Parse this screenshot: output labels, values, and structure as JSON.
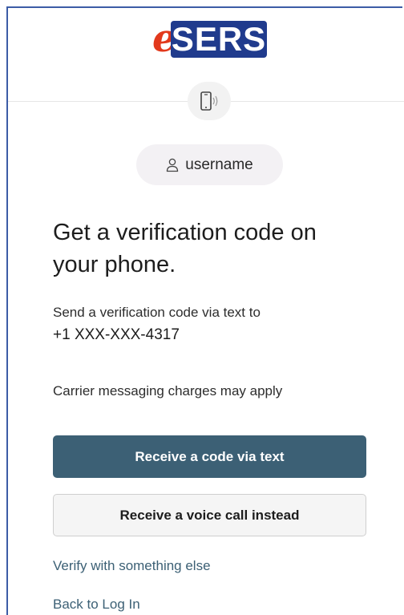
{
  "logo": {
    "prefix": "e",
    "text": "SERS"
  },
  "icons": {
    "phone": "smartphone-vibrate-icon",
    "user": "user-icon"
  },
  "user": {
    "username": "username"
  },
  "main": {
    "heading": "Get a verification code on your phone.",
    "send_text": "Send a verification code via text to",
    "phone_number": "+1 XXX-XXX-4317",
    "charges_note": "Carrier messaging charges may apply"
  },
  "actions": {
    "primary_label": "Receive a code via text",
    "secondary_label": "Receive a voice call instead",
    "verify_other_label": "Verify with something else",
    "back_label": "Back to Log In"
  },
  "colors": {
    "primary_button": "#3c6075",
    "logo_blue": "#203b8d",
    "logo_red": "#e2391c",
    "frame_border": "#3c5ca6"
  }
}
